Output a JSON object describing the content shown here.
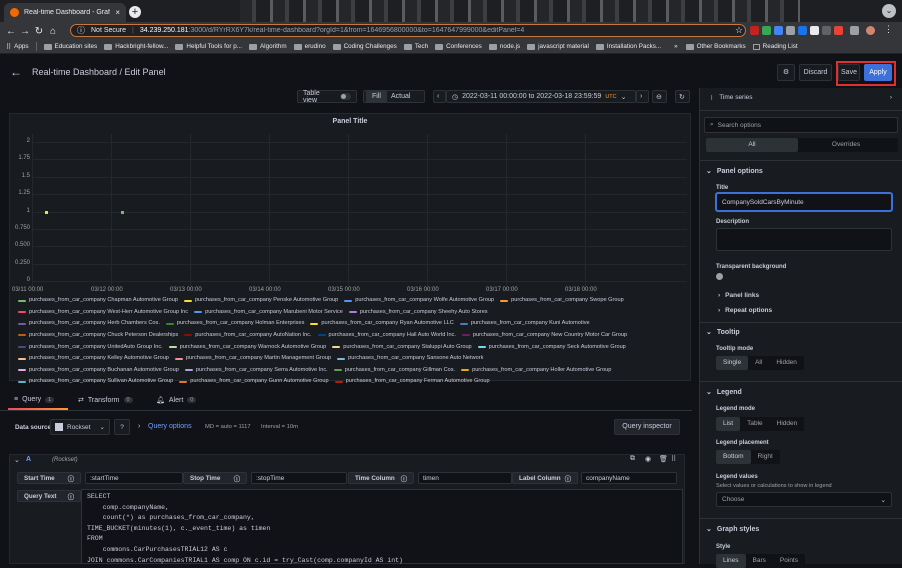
{
  "browser": {
    "tab_title": "Real-time Dashboard - Grafan",
    "not_secure": "Not Secure",
    "url_host": "34.239.250.181",
    "url_rest": ":3000/d/RYrRX6Y7k/real-time-dashboard?orgId=1&from=1646956800000&to=1647647999000&editPanel=4",
    "bookmarks": [
      "Apps",
      "Education sites",
      "Hackbright-fellow...",
      "Helpful Tools for p...",
      "Algorithm",
      "erudino",
      "Coding Challenges",
      "Tech",
      "Conferences",
      "node.js",
      "javascript material",
      "Installation Packs..."
    ],
    "other_bookmarks": "Other Bookmarks",
    "reading_list": "Reading List"
  },
  "header": {
    "title": "Real-time Dashboard / Edit Panel",
    "discard": "Discard",
    "save": "Save",
    "apply": "Apply"
  },
  "panel_toolbar": {
    "table_view": "Table view",
    "fill": "Fill",
    "actual": "Actual",
    "time_range": "2022-03-11 00:00:00 to 2022-03-18 23:59:59",
    "utc": "UTC"
  },
  "chart_data": {
    "type": "scatter",
    "title": "Panel Title",
    "y_ticks": [
      "2",
      "1.75",
      "1.5",
      "1.25",
      "1",
      "0.750",
      "0.500",
      "0.250",
      "0"
    ],
    "x_ticks": [
      "03/11 00:00",
      "03/12 00:00",
      "03/13 00:00",
      "03/14 00:00",
      "03/15 00:00",
      "03/16 00:00",
      "03/17 00:00",
      "03/18 00:00"
    ],
    "ylim": [
      0,
      2
    ],
    "points": [
      {
        "x": "03/11 ~02:00",
        "x_days": 0.08,
        "y": 1,
        "color": "#fade2a"
      },
      {
        "x": "03/12 ~01:00",
        "x_days": 1.04,
        "y": 1,
        "color": "#73bf69"
      }
    ],
    "grid": true,
    "legend_placement": "bottom"
  },
  "legend_rows": [
    [
      [
        "purchases_from_car_company Chapman Automotive Group",
        "#73bf69"
      ],
      [
        "purchases_from_car_company Penske Automotive Group",
        "#fade2a"
      ],
      [
        "purchases_from_car_company Wolfe Automotive Group",
        "#5794f2"
      ],
      [
        "purchases_from_car_company Swope Group",
        "#ff9830"
      ]
    ],
    [
      [
        "purchases_from_car_company West-Herr Automotive Group Inc",
        "#f2495c"
      ],
      [
        "purchases_from_car_company Marubeni Motor Service",
        "#5794f2"
      ],
      [
        "purchases_from_car_company Sheehy Auto Stores",
        "#b877d9"
      ]
    ],
    [
      [
        "purchases_from_car_company Herb Chambers Cos.",
        "#705da0"
      ],
      [
        "purchases_from_car_company Holman Enterprises",
        "#37872d"
      ],
      [
        "purchases_from_car_company Ryan Automotive LLC",
        "#fade2a"
      ],
      [
        "purchases_from_car_company Kuni Automotive",
        "#447ebc"
      ]
    ],
    [
      [
        "purchases_from_car_company Chuck Peterson Dealerships",
        "#c15c17"
      ],
      [
        "purchases_from_car_company AutoNation Inc.",
        "#890f02"
      ],
      [
        "purchases_from_car_company Hall Auto World Inc.",
        "#0a437c"
      ],
      [
        "purchases_from_car_company New Country Motor Car Group",
        "#6d1f62"
      ]
    ],
    [
      [
        "purchases_from_car_company UnitedAuto Group Inc.",
        "#584477"
      ],
      [
        "purchases_from_car_company Warnock Automotive Group",
        "#b7dbab"
      ],
      [
        "purchases_from_car_company Staluppi Auto Group",
        "#f4d598"
      ],
      [
        "purchases_from_car_company Seck Automotive Group",
        "#70dbed"
      ]
    ],
    [
      [
        "purchases_from_car_company Kelley Automotive Group",
        "#f9ba8f"
      ],
      [
        "purchases_from_car_company Martin Management Group",
        "#f29191"
      ],
      [
        "purchases_from_car_company Sansone Auto Network",
        "#82b5d8"
      ]
    ],
    [
      [
        "purchases_from_car_company Buchanan Automotive Group",
        "#e5a8e2"
      ],
      [
        "purchases_from_car_company Serra Automotive Inc.",
        "#aea2e0"
      ],
      [
        "purchases_from_car_company Gillman Cos.",
        "#629e51"
      ],
      [
        "purchases_from_car_company Holler Automotive Group",
        "#e5ac0e"
      ]
    ],
    [
      [
        "purchases_from_car_company Sullivan Automotive Group",
        "#64b0c8"
      ],
      [
        "purchases_from_car_company Gunn Automotive Group",
        "#e0752d"
      ],
      [
        "purchases_from_car_company Ferman Automotive Group",
        "#bf1b00"
      ]
    ]
  ],
  "query_tabs": [
    {
      "label": "Query",
      "count": "1"
    },
    {
      "label": "Transform",
      "count": "0"
    },
    {
      "label": "Alert",
      "count": "0"
    }
  ],
  "query": {
    "data_source_label": "Data source",
    "data_source": "Rockset",
    "query_options": "Query options",
    "md_info": "MD = auto = 1117",
    "interval_info": "Interval = 10m",
    "query_inspector": "Query inspector",
    "ref_id": "A",
    "ds_tag": "(Rockset)",
    "start_time_label": "Start Time",
    "start_time": ":startTime",
    "stop_time_label": "Stop Time",
    "stop_time": ":stopTime",
    "time_column_label": "Time Column",
    "time_column": "timen",
    "label_column_label": "Label Column",
    "label_column": "companyName",
    "query_text_label": "Query Text",
    "sql": "SELECT\n    comp.companyName,\n    count(*) as purchases_from_car_company,\nTIME_BUCKET(minutes(1), c._event_time) as timen\nFROM\n    commons.CarPurchasesTRIAL12 AS c\nJOIN commons.CarCompaniesTRIAL1 AS comp ON c.id = try_Cast(comp.companyId AS int)"
  },
  "options": {
    "viz": "Time series",
    "search_placeholder": "Search options",
    "all": "All",
    "overrides": "Overrides",
    "panel_options": "Panel options",
    "title_label": "Title",
    "title_value": "CompanySoldCarsByMinute",
    "description_label": "Description",
    "transparent_label": "Transparent background",
    "panel_links": "Panel links",
    "repeat_options": "Repeat options",
    "tooltip": "Tooltip",
    "tooltip_mode": "Tooltip mode",
    "tooltip_modes": [
      "Single",
      "All",
      "Hidden"
    ],
    "legend": "Legend",
    "legend_mode": "Legend mode",
    "legend_modes": [
      "List",
      "Table",
      "Hidden"
    ],
    "legend_placement": "Legend placement",
    "placements": [
      "Bottom",
      "Right"
    ],
    "legend_values": "Legend values",
    "legend_values_sub": "Select values or calculations to show in legend",
    "choose": "Choose",
    "graph_styles": "Graph styles",
    "style": "Style",
    "styles": [
      "Lines",
      "Bars",
      "Points"
    ]
  }
}
